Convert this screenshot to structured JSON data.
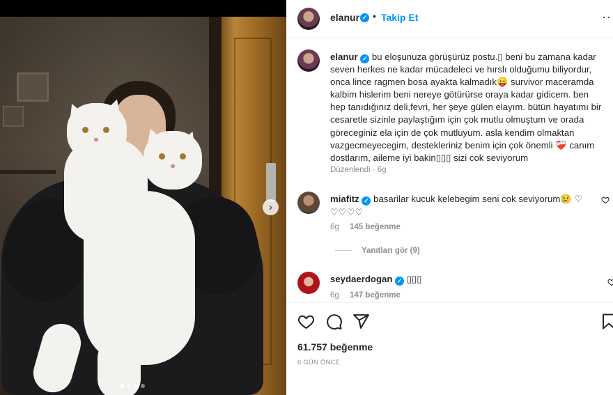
{
  "post": {
    "username": "elanur",
    "separator": "•",
    "follow_label": "Takip Et",
    "more_label": "···",
    "verified_mark": "✓",
    "caption": "bu eloşunuza görüşürüz postu.▯ beni bu zamana kadar seven herkes ne kadar mücadeleci ve hırslı olduğumu biliyordur, onca lince ragmen bosa ayakta kalmadık😛 survivor maceramda kalbim hislerim beni nereye götürürse oraya kadar gidicem. ben hep tanıdığınız deli,fevri, her şeye gülen elayım. bütün hayatımı bir cesaretle sizinle paylaştığım için çok mutlu olmuştum ve orada göreceginiz ela için de çok mutluyum. asla kendim olmaktan vazgecmeyecegim, destekleriniz benim için çok önemli ❤️‍🩹 canım dostlarım, aileme iyi bakin▯▯▯ sizi cok seviyorum",
    "edited_label": "Düzenlendi · 6g",
    "likes_total": "61.757 beğenme",
    "date": "6 GÜN ÖNCE",
    "carousel_next": "›",
    "carousel": {
      "count": 4,
      "active_index": 0
    }
  },
  "comments": [
    {
      "username": "miafitz",
      "text": "basarilar kucuk kelebegim seni cok seviyorum😢 ♡ ♡♡♡♡",
      "time": "6g",
      "likes": "145 beğenme",
      "replies_label": "Yanıtları gör (9)"
    },
    {
      "username": "seydaerdogan",
      "text": "▯▯▯",
      "time": "6g",
      "likes": "147 beğenme"
    }
  ],
  "icons": {
    "like": "heart-icon",
    "comment": "comment-icon",
    "share": "share-icon",
    "save": "bookmark-icon",
    "comment_like": "heart-outline-icon"
  },
  "colors": {
    "link_blue": "#0095f6",
    "text": "#262626",
    "muted": "#8e8e8e",
    "border": "#efefef"
  }
}
